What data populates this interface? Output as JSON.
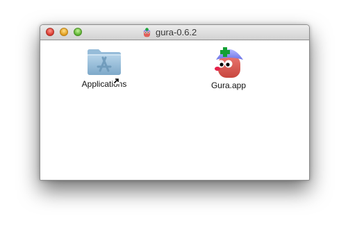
{
  "window": {
    "title": "gura-0.6.2",
    "title_icon": "gura-app-icon"
  },
  "items": [
    {
      "label": "Applications",
      "icon": "applications-folder-icon",
      "is_alias": true
    },
    {
      "label": "Gura.app",
      "icon": "gura-app-icon",
      "is_alias": false
    }
  ],
  "colors": {
    "close": "#ff5f57",
    "minimize": "#ffbd2e",
    "maximize": "#28c940"
  }
}
